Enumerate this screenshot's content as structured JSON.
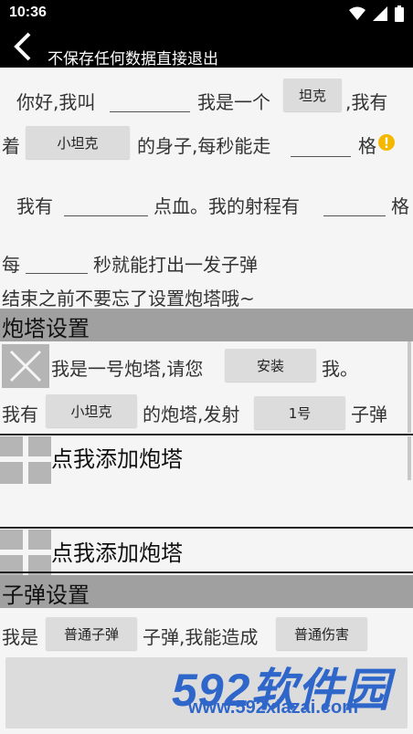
{
  "status_bar": {
    "time": "10:36"
  },
  "toolbar": {
    "title": "不保存任何数据直接退出"
  },
  "form": {
    "t_hello": "你好,我叫",
    "t_iam": "我是一个",
    "btn_type": "坦克",
    "t_ihave": ",我有",
    "t_zhe": "着",
    "btn_body": "小坦克",
    "t_body": "的身子,每秒能走",
    "t_ge1": "格",
    "t_youhave": "我有",
    "t_hp": "点血。我的射程有",
    "t_ge2": "格",
    "t_every": "每",
    "t_seconds": "秒就能打出一发子弹",
    "t_reminder": "结束之前不要忘了设置炮塔哦~"
  },
  "turret_section": {
    "header": "炮塔设置",
    "turret1": {
      "t_intro": "我是一号炮塔,请您",
      "btn_install": "安装",
      "t_me": "我。",
      "t_ihave": "我有",
      "btn_type": "小坦克",
      "t_launch": "的炮塔,发射",
      "btn_bullet": "1号",
      "t_bullet": "子弹"
    },
    "add_label_1": "点我添加炮塔",
    "add_label_2": "点我添加炮塔"
  },
  "bullet_section": {
    "header": "子弹设置",
    "t_iam": "我是",
    "btn_type": "普通子弹",
    "t_cause": "子弹,我能造成",
    "btn_damage": "普通伤害"
  },
  "watermark": {
    "brand": "592软件园",
    "url": "www.592xiazai.com"
  },
  "colors": {
    "accent_warning": "#f5b800",
    "watermark": "#2f66c9",
    "header_bg": "#a0a0a0"
  }
}
